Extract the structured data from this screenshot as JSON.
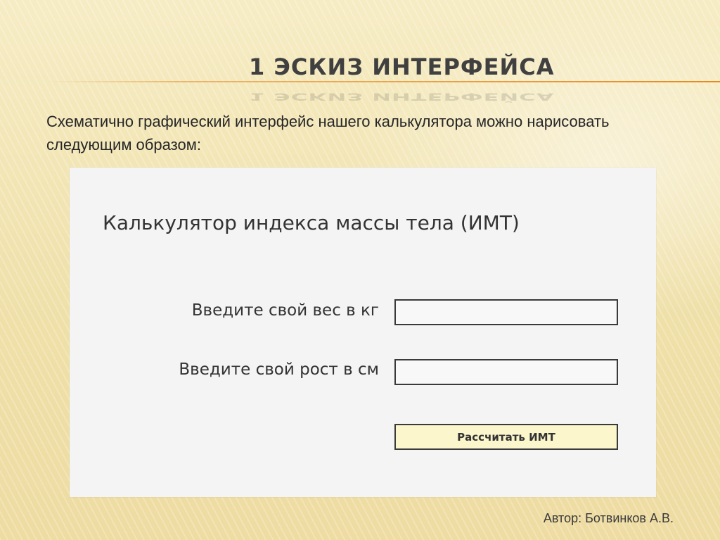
{
  "slide": {
    "title": "1 ЭСКИЗ ИНТЕРФЕЙСА",
    "intro_text": "Схематично графический интерфейс нашего калькулятора можно нарисовать следующим образом:",
    "author": "Автор: Ботвинков А.В."
  },
  "sketch": {
    "heading": "Калькулятор индекса массы тела (ИМТ)",
    "weight_label": "Введите свой вес в кг",
    "weight_value": "",
    "height_label": "Введите свой рост в см",
    "height_value": "",
    "calculate_button_label": "Рассчитать ИМТ"
  },
  "colors": {
    "background": "#f2e6b6",
    "title_rule": "#e8891f",
    "button_fill": "#fbf6cc",
    "sketch_panel": "#f4f4f4"
  }
}
